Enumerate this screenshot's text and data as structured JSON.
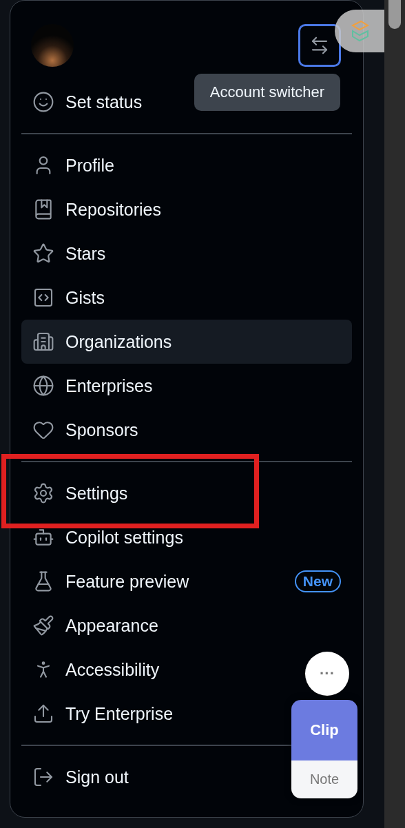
{
  "header": {
    "account_switcher_tooltip": "Account switcher"
  },
  "status_item": {
    "label": "Set status"
  },
  "sections": [
    {
      "items": [
        {
          "label": "Profile",
          "selected": false
        },
        {
          "label": "Repositories",
          "selected": false
        },
        {
          "label": "Stars",
          "selected": false
        },
        {
          "label": "Gists",
          "selected": false
        },
        {
          "label": "Organizations",
          "selected": true
        },
        {
          "label": "Enterprises",
          "selected": false
        },
        {
          "label": "Sponsors",
          "selected": false
        }
      ]
    },
    {
      "items": [
        {
          "label": "Settings",
          "selected": false
        },
        {
          "label": "Copilot settings",
          "selected": false
        },
        {
          "label": "Feature preview",
          "selected": false,
          "badge": "New"
        },
        {
          "label": "Appearance",
          "selected": false
        },
        {
          "label": "Accessibility",
          "selected": false
        },
        {
          "label": "Try Enterprise",
          "selected": false
        }
      ]
    },
    {
      "items": [
        {
          "label": "Sign out",
          "selected": false
        }
      ]
    }
  ],
  "clip_widget": {
    "more": "···",
    "clip": "Clip",
    "note": "Note"
  }
}
